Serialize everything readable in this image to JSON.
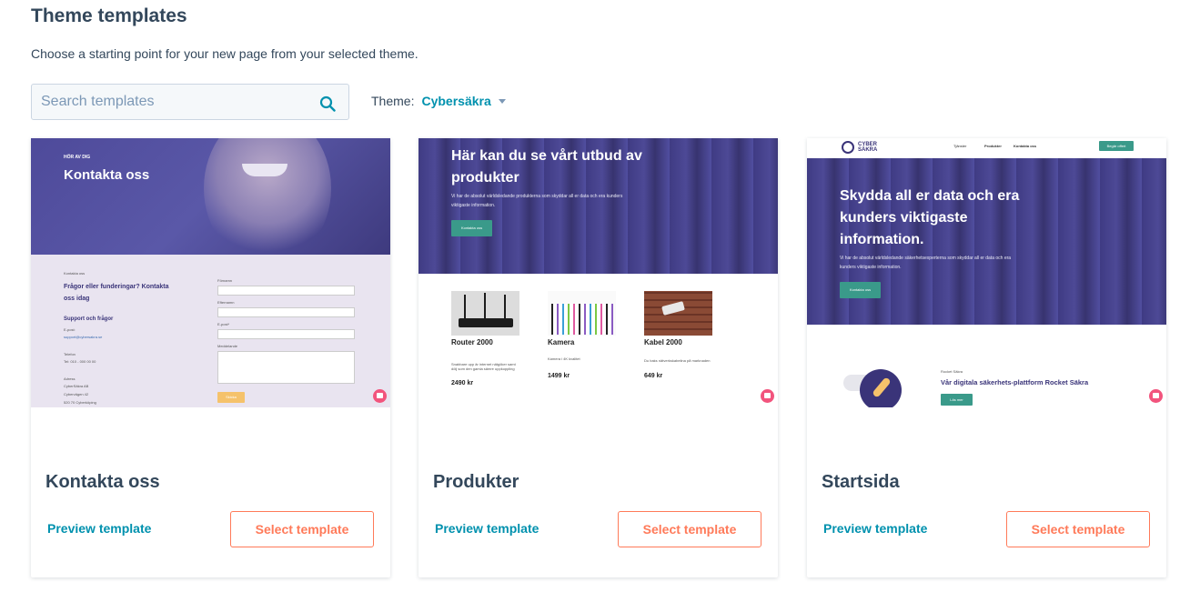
{
  "header": {
    "title": "Theme templates",
    "subtitle": "Choose a starting point for your new page from your selected theme."
  },
  "search": {
    "placeholder": "Search templates",
    "value": ""
  },
  "theme": {
    "label": "Theme:",
    "selected": "Cybersäkra"
  },
  "colors": {
    "link": "#0091ae",
    "accent": "#ff7a59",
    "text": "#33475b",
    "hero_purple": "#4e4a9a",
    "cta_green": "#3a9a8a"
  },
  "cards": [
    {
      "title": "Kontakta oss",
      "preview_label": "Preview template",
      "select_label": "Select template",
      "thumb": {
        "eyebrow": "HÖR AV DIG",
        "heading": "Kontakta oss",
        "small_label": "Kontakta oss",
        "left_heading": "Frågor eller funderingar? Kontakta oss idag",
        "support_heading": "Support och frågor",
        "email_label": "E-post:",
        "email_value": "support@cybersakra.se",
        "phone_label": "Telefon",
        "phone_value": "Tel: 010 - 000 00 00",
        "address_label": "Adress",
        "address_lines": [
          "CyberSäkra AB",
          "Cybervägen 42",
          "520 70 Cyberköping"
        ],
        "form_labels": [
          "Förnamn",
          "Efternamn",
          "E-post*",
          "Meddelande"
        ],
        "submit": "Skicka"
      }
    },
    {
      "title": "Produkter",
      "preview_label": "Preview template",
      "select_label": "Select template",
      "thumb": {
        "heading": "Här kan du se vårt utbud av produkter",
        "body": "Vi har de absolut världsledande produkterna som skyddar all er data och era kunders viktigaste information.",
        "cta": "Kontakta oss",
        "products": [
          {
            "name": "Router 2000",
            "desc": "Snabbare upp är internet nätgöker samt dölj som den gamla sämre uppkoppling",
            "price": "2490 kr",
            "icon": "router-image"
          },
          {
            "name": "Kamera",
            "desc": "Kamera i 4K kvalitet",
            "price": "1499 kr",
            "icon": "cables-image"
          },
          {
            "name": "Kabel 2000",
            "desc": "Du baks nätverkskabelina på marknaden",
            "price": "649 kr",
            "icon": "camera-image"
          }
        ]
      }
    },
    {
      "title": "Startsida",
      "preview_label": "Preview template",
      "select_label": "Select template",
      "thumb": {
        "logo": "CYBER SÄKRA",
        "nav": [
          "Tjänster",
          "Produkter",
          "Kontakta oss"
        ],
        "nav_cta": "Begär offert",
        "heading": "Skydda all er data och era kunders viktigaste information.",
        "body": "Vi har de absolut världsledande säkerhetsexperterna som skyddar all er data och era kunders viktigaste information.",
        "cta": "Kontakta oss",
        "feature_label": "Rocket Säkra",
        "feature_heading": "Vår digitala säkerhets-plattform Rocket Säkra",
        "feature_cta": "Läs mer"
      }
    }
  ]
}
